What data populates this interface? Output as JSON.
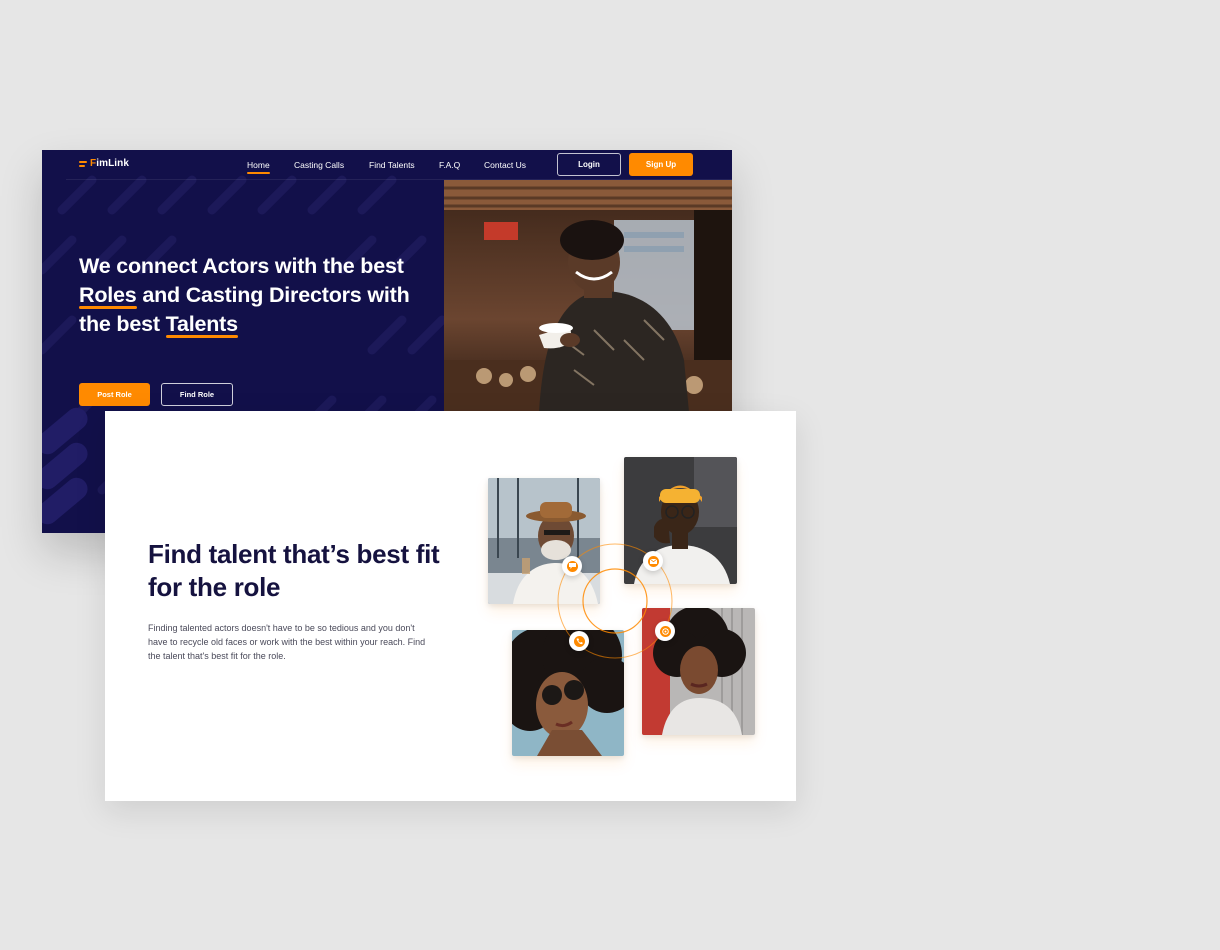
{
  "brand": {
    "logo_text_accent": "F",
    "logo_text_rest": "imLink"
  },
  "nav": {
    "items": [
      {
        "label": "Home"
      },
      {
        "label": "Casting Calls"
      },
      {
        "label": "Find Talents"
      },
      {
        "label": "F.A.Q"
      },
      {
        "label": "Contact Us"
      }
    ],
    "login_label": "Login",
    "signup_label": "Sign Up"
  },
  "hero": {
    "title_part1": "We connect Actors with the best ",
    "title_hl1": "Roles",
    "title_part2": " and Casting Directors with the best ",
    "title_hl2": "Talents",
    "post_role_label": "Post Role",
    "find_role_label": "Find Role"
  },
  "feature": {
    "title": "Find talent that’s best fit for the role",
    "description": "Finding talented actors doesn't have to be so tedious and you don't have to recycle old faces or work with the best within your reach. Find the talent that's best fit for the role."
  },
  "icons": {
    "logo": "filmlink-logo-icon",
    "chat": "chat-bubble-icon",
    "mail": "mail-icon",
    "phone": "phone-icon",
    "whatsapp": "whatsapp-icon"
  },
  "colors": {
    "accent": "#ff8a00",
    "hero_bg": "#12104a",
    "heading": "#15123f",
    "page_bg": "#e6e6e6"
  }
}
